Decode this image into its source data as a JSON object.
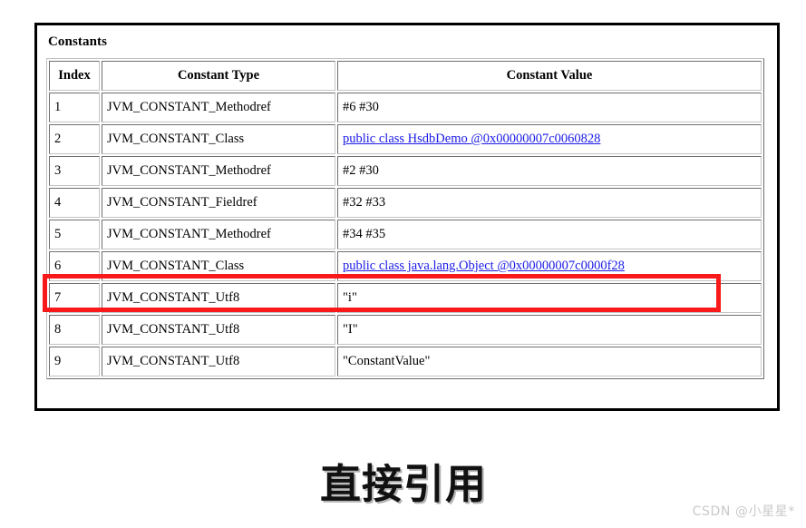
{
  "panel": {
    "title": "Constants"
  },
  "table": {
    "headers": [
      "Index",
      "Constant Type",
      "Constant Value"
    ],
    "rows": [
      {
        "index": "1",
        "type": "JVM_CONSTANT_Methodref",
        "value": "#6 #30",
        "is_link": false
      },
      {
        "index": "2",
        "type": "JVM_CONSTANT_Class",
        "value": "public class HsdbDemo @0x00000007c0060828",
        "is_link": true
      },
      {
        "index": "3",
        "type": "JVM_CONSTANT_Methodref",
        "value": "#2 #30",
        "is_link": false
      },
      {
        "index": "4",
        "type": "JVM_CONSTANT_Fieldref",
        "value": "#32 #33",
        "is_link": false
      },
      {
        "index": "5",
        "type": "JVM_CONSTANT_Methodref",
        "value": "#34 #35",
        "is_link": false
      },
      {
        "index": "6",
        "type": "JVM_CONSTANT_Class",
        "value": "public class java.lang.Object @0x00000007c0000f28",
        "is_link": true
      },
      {
        "index": "7",
        "type": "JVM_CONSTANT_Utf8",
        "value": "\"i\"",
        "is_link": false
      },
      {
        "index": "8",
        "type": "JVM_CONSTANT_Utf8",
        "value": "\"I\"",
        "is_link": false
      },
      {
        "index": "9",
        "type": "JVM_CONSTANT_Utf8",
        "value": "\"ConstantValue\"",
        "is_link": false
      }
    ],
    "highlighted_row_index": "6"
  },
  "annotation": {
    "highlight_color": "#f81a1a"
  },
  "caption": {
    "text": "直接引用"
  },
  "watermark": {
    "text": "CSDN @小星星*",
    "color": "#c9c9c9"
  },
  "colors": {
    "link": "#1a1ae6",
    "frame_border": "#000000",
    "table_border": "#c4c4c4",
    "background": "#ffffff"
  }
}
